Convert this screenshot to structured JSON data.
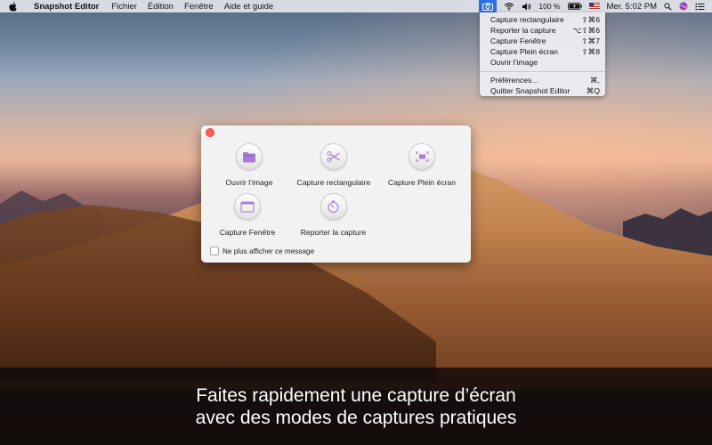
{
  "menubar": {
    "app_name": "Snapshot Editor",
    "menus": [
      "Fichier",
      "Édition",
      "Fenêtre",
      "Aide et guide"
    ],
    "battery_text": "100 %",
    "clock": "Mer. 5:02 PM",
    "icons": [
      "apple-icon",
      "camera-icon",
      "wifi-icon",
      "volume-icon",
      "battery-icon",
      "flag-icon",
      "spotlight-icon",
      "siri-icon",
      "notification-center-icon"
    ]
  },
  "dropdown": {
    "items": [
      {
        "label": "Capture rectangulaire",
        "shortcut": "⇧⌘6"
      },
      {
        "label": "Reporter la capture",
        "shortcut": "⌥⇧⌘6"
      },
      {
        "label": "Capture Fenêtre",
        "shortcut": "⇧⌘7"
      },
      {
        "label": "Capture Plein écran",
        "shortcut": "⇧⌘8"
      },
      {
        "label": "Ouvrir l’image",
        "shortcut": ""
      },
      {
        "label": "Préférences...",
        "shortcut": "⌘,"
      },
      {
        "label": "Quitter Snapshot Editor",
        "shortcut": "⌘Q"
      }
    ]
  },
  "dialog": {
    "tools": [
      {
        "label": "Ouvrir l’image",
        "icon": "folder-icon"
      },
      {
        "label": "Capture rectangulaire",
        "icon": "scissors-icon"
      },
      {
        "label": "Capture Plein écran",
        "icon": "fullscreen-icon"
      },
      {
        "label": "Capture Fenêtre",
        "icon": "window-icon"
      },
      {
        "label": "Reporter la capture",
        "icon": "timer-icon"
      }
    ],
    "checkbox_label": "Ne plus afficher ce message",
    "accent_color": "#a77bd6"
  },
  "caption": {
    "line1": "Faites rapidement une capture d’écran",
    "line2": "avec des modes de captures pratiques"
  }
}
